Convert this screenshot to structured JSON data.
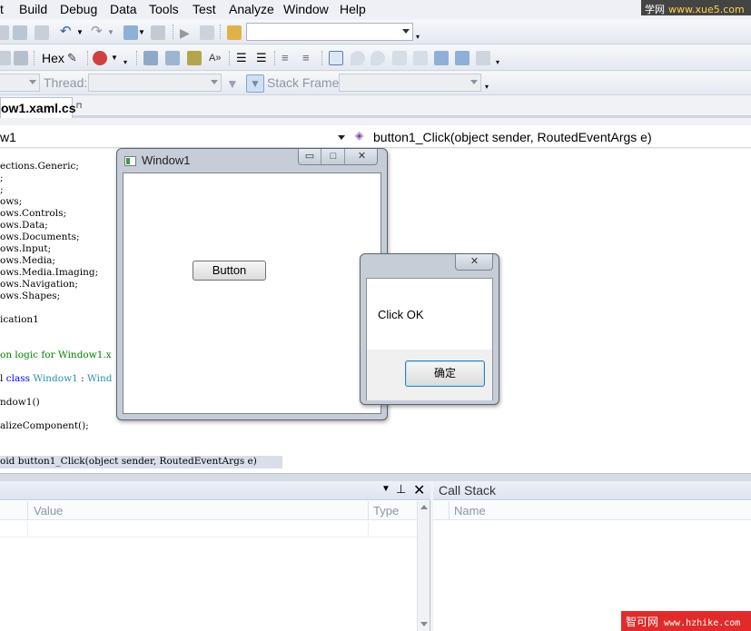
{
  "menubar": {
    "items": [
      "t",
      "Build",
      "Debug",
      "Data",
      "Tools",
      "Test",
      "Analyze",
      "Window",
      "Help"
    ]
  },
  "watermarks": {
    "top_prefix": "学网",
    "top_site": "www.xue5.com",
    "bottom_prefix": "智可网",
    "bottom_site": "www.hzhike.com"
  },
  "toolbar2": {
    "hex_label": "Hex"
  },
  "toolbar3": {
    "thread_label": "Thread:",
    "stack_frame_label": "Stack Frame:"
  },
  "document_tab": {
    "label": "ow1.xaml.cs"
  },
  "navbar": {
    "type_value": "w1",
    "member_value": "button1_Click(object sender, RoutedEventArgs e)"
  },
  "code_lines": [
    "ections.Generic;",
    ";",
    ";",
    "ows;",
    "ows.Controls;",
    "ows.Data;",
    "ows.Documents;",
    "ows.Input;",
    "ows.Media;",
    "ows.Media.Imaging;",
    "ows.Navigation;",
    "ows.Shapes;",
    "",
    "ication1",
    "",
    "",
    "on logic for Window1.x",
    "",
    "l class Window1 : Wind",
    "",
    "ndow1()",
    "",
    "alizeComponent();",
    "",
    "",
    "oid button1_Click(object sender, RoutedEventArgs e)"
  ],
  "window1": {
    "title": "Window1",
    "button_label": "Button"
  },
  "msgbox": {
    "message": "Click OK",
    "ok_label": "确定"
  },
  "locals": {
    "col_value": "Value",
    "col_type": "Type"
  },
  "callstack": {
    "title": "Call Stack",
    "col_name": "Name"
  }
}
